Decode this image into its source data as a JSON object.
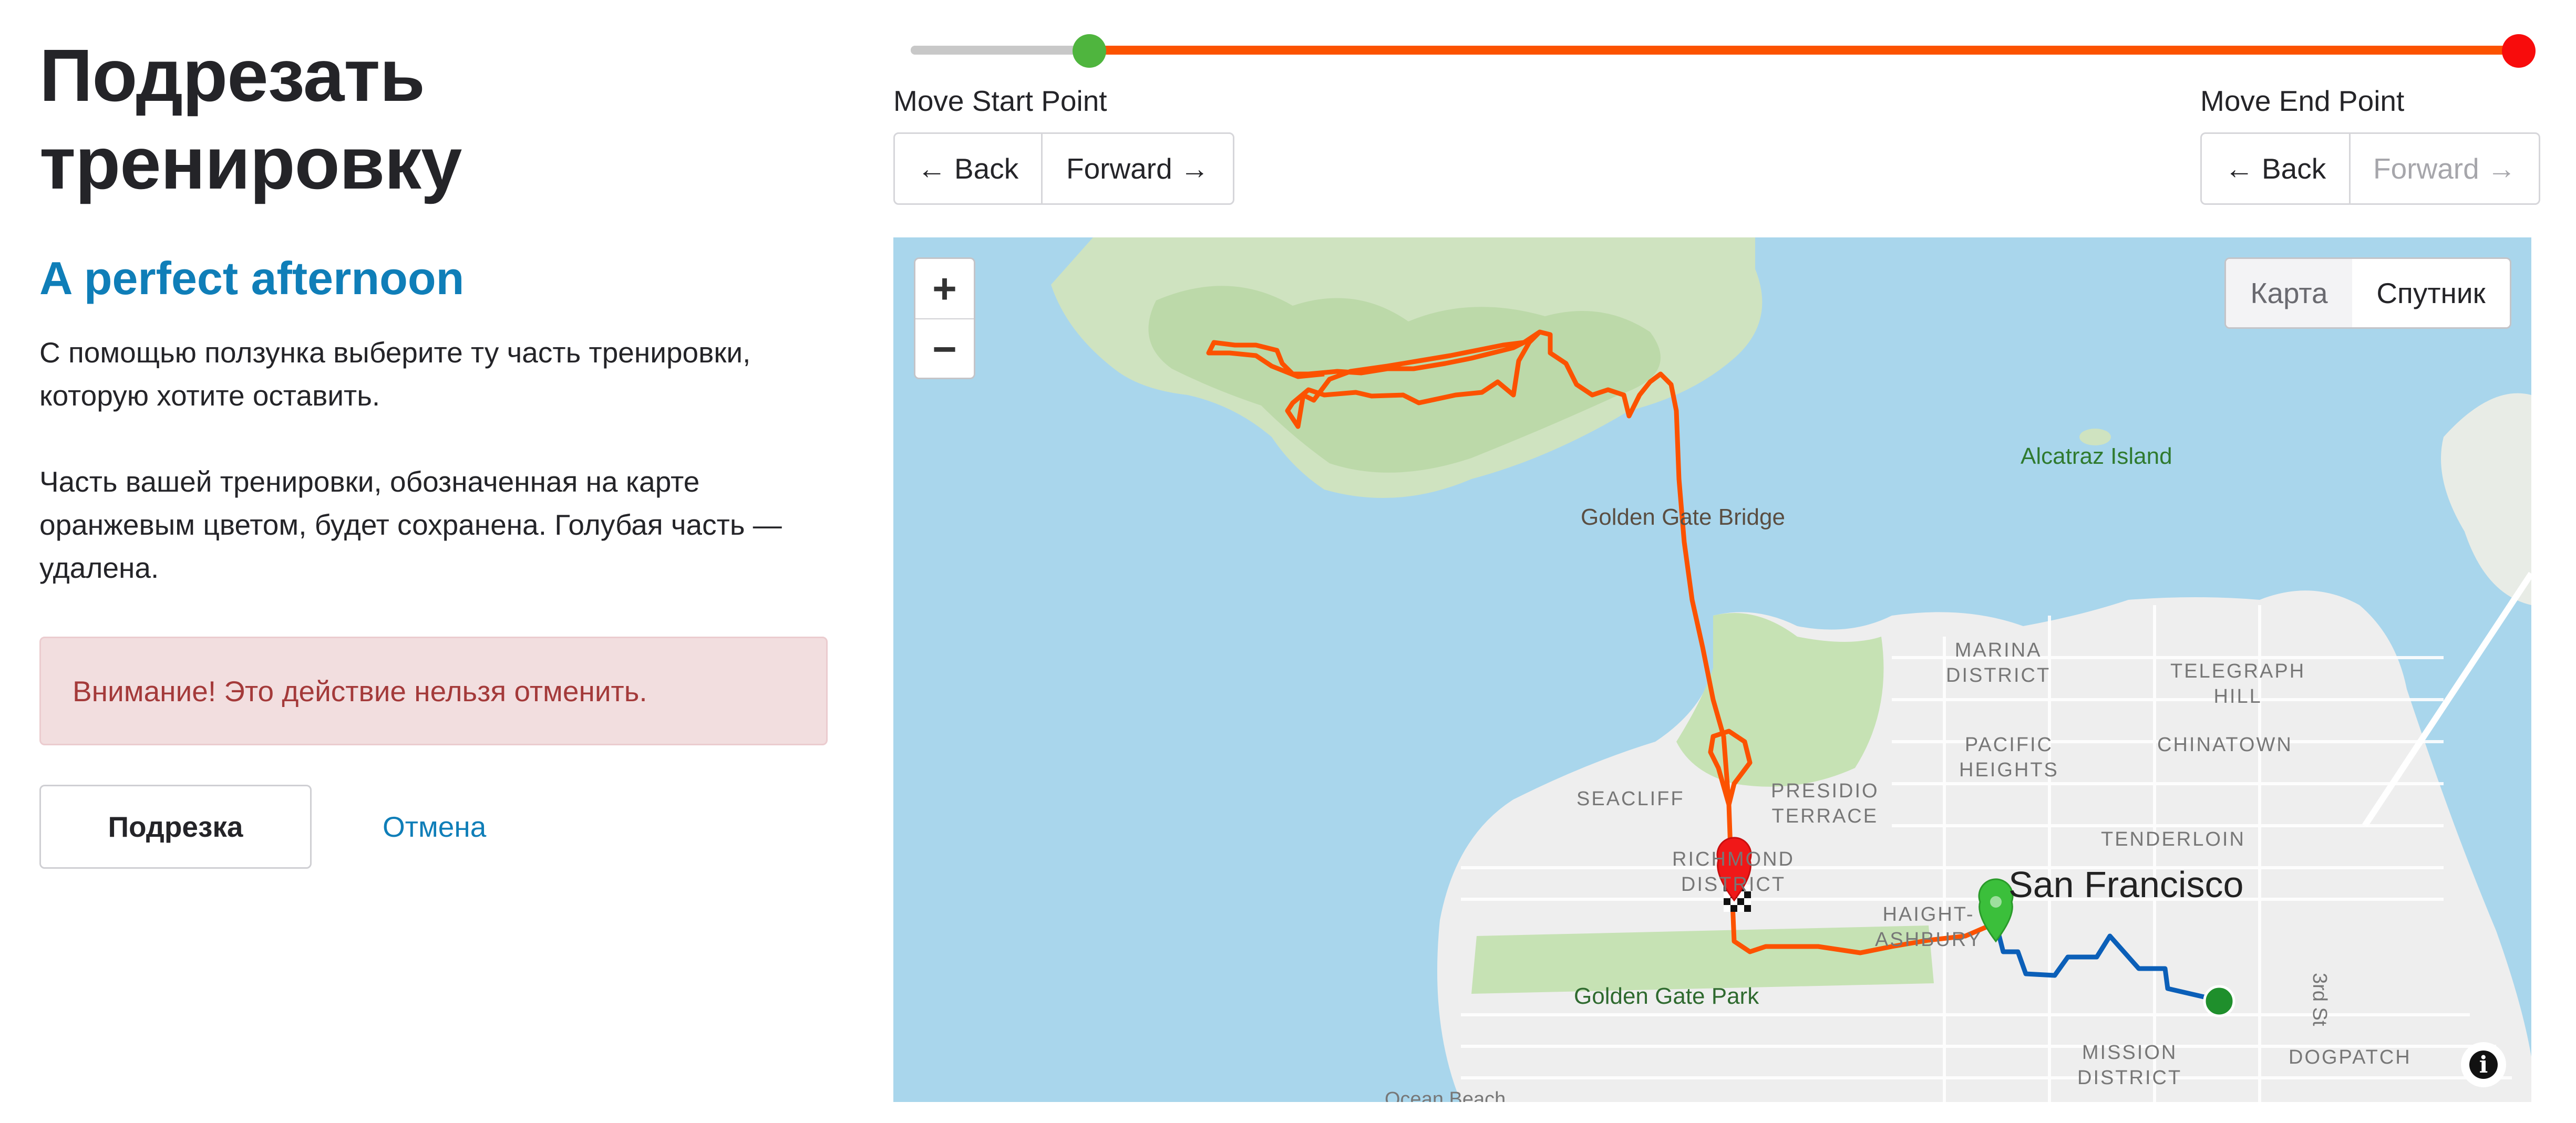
{
  "left": {
    "title_line1": "Подрезать",
    "title_line2": "тренировку",
    "activity_name": "A perfect afternoon",
    "description_1": "С помощью ползунка выберите ту часть тренировки, которую хотите оставить.",
    "description_2": "Часть вашей тренировки, обозначенная на карте оранжевым цветом, будет сохранена. Голубая часть — удалена.",
    "warning": "Внимание! Это действие нельзя отменить.",
    "crop_button": "Подрезка",
    "cancel_link": "Отмена"
  },
  "slider": {
    "start_fraction": 0.11,
    "end_fraction": 1.0,
    "colors": {
      "kept": "#fc5200",
      "removed": "#c8c8c8",
      "start_handle": "#4fb53e",
      "end_handle": "#f80c0c"
    }
  },
  "start_controls": {
    "label": "Move Start Point",
    "back": "← Back",
    "forward": "Forward →"
  },
  "end_controls": {
    "label": "Move End Point",
    "back": "← Back",
    "forward": "Forward →",
    "forward_disabled": true
  },
  "map": {
    "zoom_in": "+",
    "zoom_out": "−",
    "type_map": "Карта",
    "type_satellite": "Спутник",
    "info": "i",
    "labels": {
      "alcatraz": "Alcatraz Island",
      "golden_gate_bridge": "Golden Gate Bridge",
      "marina": [
        "MARINA",
        "DISTRICT"
      ],
      "telegraph": [
        "TELEGRAPH",
        "HILL"
      ],
      "pacific": [
        "PACIFIC",
        "HEIGHTS"
      ],
      "chinatown": "CHINATOWN",
      "seacliff": "SEACLIFF",
      "presidio": [
        "PRESIDIO",
        "TERRACE"
      ],
      "tenderloin": "TENDERLOIN",
      "richmond": [
        "RICHMOND",
        "DISTRICT"
      ],
      "san_francisco": "San Francisco",
      "haight": [
        "HAIGHT-",
        "ASHBURY"
      ],
      "golden_gate_park": "Golden Gate Park",
      "mission": [
        "MISSION",
        "DISTRICT"
      ],
      "dogpatch": "DOGPATCH",
      "third_st": "3rd St",
      "ocean_beach": "Ocean Beach"
    },
    "route_colors": {
      "kept": "#fc5200",
      "removed": "#0b5fb8"
    }
  }
}
